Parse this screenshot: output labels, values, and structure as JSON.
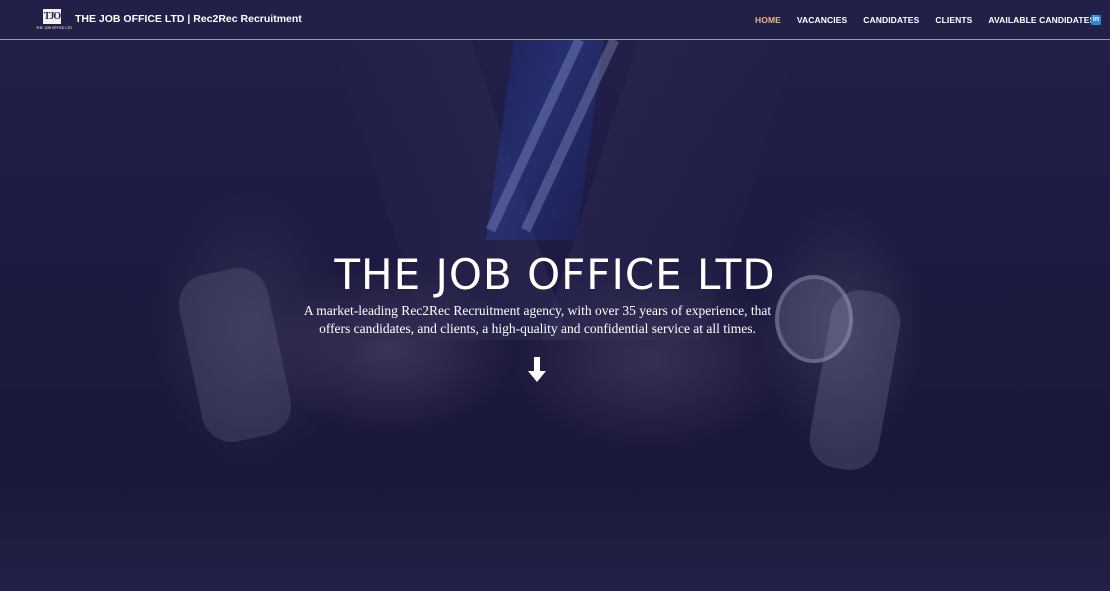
{
  "header": {
    "logo_text": "TJO",
    "logo_subtext": "THE JOB OFFICE LTD",
    "site_title": "THE JOB OFFICE LTD | Rec2Rec Recruitment",
    "nav": [
      {
        "label": "HOME",
        "active": true
      },
      {
        "label": "VACANCIES",
        "active": false
      },
      {
        "label": "CANDIDATES",
        "active": false
      },
      {
        "label": "CLIENTS",
        "active": false
      },
      {
        "label": "AVAILABLE CANDIDATES",
        "active": false
      }
    ],
    "social_icon": "linkedin-icon",
    "social_label": "in"
  },
  "hero": {
    "title": "THE JOB OFFICE LTD",
    "subtitle": "A market-leading Rec2Rec Recruitment agency, with over 35 years of experience, that offers candidates, and clients, a high-quality and confidential service at all times.",
    "scroll_icon": "arrow-down-icon"
  },
  "colors": {
    "header_bg": "#23214a",
    "active_nav": "#e8b77c",
    "linkedin": "#2f86d6",
    "text": "#ffffff"
  }
}
